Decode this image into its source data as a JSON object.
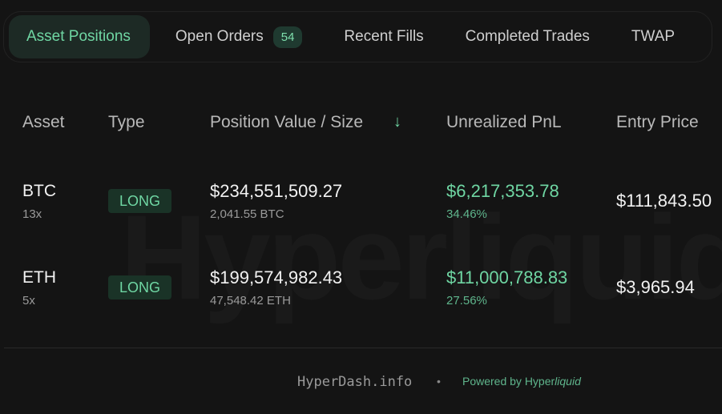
{
  "watermark": "Hyperliquid",
  "tabs": [
    {
      "label": "Asset Positions",
      "active": true
    },
    {
      "label": "Open Orders",
      "badge": "54"
    },
    {
      "label": "Recent Fills"
    },
    {
      "label": "Completed Trades"
    },
    {
      "label": "TWAP"
    }
  ],
  "columns": {
    "asset": "Asset",
    "type": "Type",
    "position": "Position Value / Size",
    "sort_icon": "arrow-down-icon",
    "pnl": "Unrealized PnL",
    "entry": "Entry Price"
  },
  "rows": [
    {
      "asset": "BTC",
      "leverage": "13x",
      "type": "LONG",
      "value": "$234,551,509.27",
      "size": "2,041.55 BTC",
      "pnl": "$6,217,353.78",
      "pnl_pct": "34.46%",
      "entry": "$111,843.50"
    },
    {
      "asset": "ETH",
      "leverage": "5x",
      "type": "LONG",
      "value": "$199,574,982.43",
      "size": "47,548.42 ETH",
      "pnl": "$11,000,788.83",
      "pnl_pct": "27.56%",
      "entry": "$3,965.94"
    }
  ],
  "footer": {
    "site": "HyperDash.info",
    "separator": "•",
    "powered_prefix": "Powered by Hyper",
    "powered_suffix": "liquid"
  },
  "colors": {
    "background": "#141414",
    "accent_green": "#6fd6a3",
    "active_tab_bg": "#1d2a25"
  }
}
